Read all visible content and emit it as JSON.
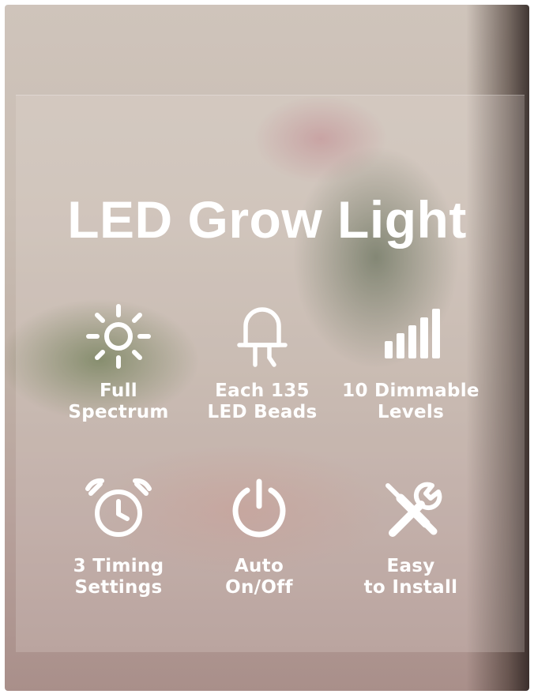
{
  "title": "LED Grow Light",
  "features": [
    {
      "icon": "sun-icon",
      "line1": "Full",
      "line2": "Spectrum"
    },
    {
      "icon": "led-bulb-icon",
      "line1": "Each 135",
      "line2": "LED Beads"
    },
    {
      "icon": "signal-bars-icon",
      "line1": "10 Dimmable",
      "line2": "Levels"
    },
    {
      "icon": "alarm-clock-icon",
      "line1": "3 Timing",
      "line2": "Settings"
    },
    {
      "icon": "power-icon",
      "line1": "Auto",
      "line2": "On/Off"
    },
    {
      "icon": "tools-icon",
      "line1": "Easy",
      "line2": "to Install"
    }
  ],
  "colors": {
    "text": "#ffffff",
    "overlay": "#ebe4de"
  }
}
